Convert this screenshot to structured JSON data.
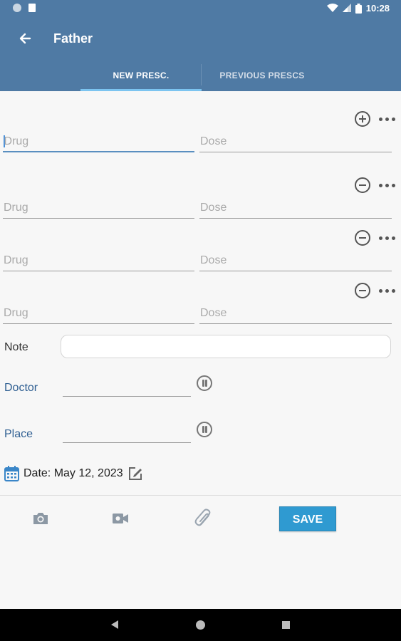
{
  "status_bar": {
    "time": "10:28"
  },
  "app_bar": {
    "title": "Father"
  },
  "tabs": [
    {
      "label": "NEW PRESC."
    },
    {
      "label": "PREVIOUS PRESCS"
    }
  ],
  "prescription_rows": [
    {
      "drug_placeholder": "Drug",
      "dose_placeholder": "Dose",
      "action": "add"
    },
    {
      "drug_placeholder": "Drug",
      "dose_placeholder": "Dose",
      "action": "remove"
    },
    {
      "drug_placeholder": "Drug",
      "dose_placeholder": "Dose",
      "action": "remove"
    },
    {
      "drug_placeholder": "Drug",
      "dose_placeholder": "Dose",
      "action": "remove"
    }
  ],
  "form": {
    "note_label": "Note",
    "doctor_label": "Doctor",
    "place_label": "Place",
    "date_text": "Date: May 12, 2023"
  },
  "bottom_bar": {
    "save_label": "SAVE"
  },
  "colors": {
    "app_bar": "#4f7aa4",
    "accent": "#2f9ad1",
    "label_blue": "#2f5f92"
  }
}
